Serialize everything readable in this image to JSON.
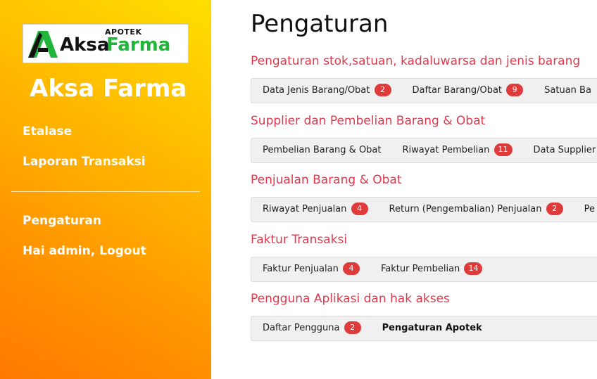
{
  "sidebar": {
    "logo": {
      "apotek": "APOTEK",
      "aksa": "Aksa",
      "farma": "Farma"
    },
    "brand": "Aksa Farma",
    "items": [
      "Etalase",
      "Laporan Transaksi",
      "Pengaturan",
      "Hai admin, Logout"
    ]
  },
  "main": {
    "title": "Pengaturan",
    "sections": [
      {
        "title": "Pengaturan stok,satuan, kadaluwarsa dan jenis barang",
        "links": [
          {
            "label": "Data Jenis Barang/Obat",
            "badge": "2"
          },
          {
            "label": "Daftar Barang/Obat",
            "badge": "9"
          },
          {
            "label": "Satuan Ba",
            "badge": ""
          }
        ]
      },
      {
        "title": "Supplier dan Pembelian Barang & Obat",
        "links": [
          {
            "label": "Pembelian Barang & Obat",
            "badge": ""
          },
          {
            "label": "Riwayat Pembelian",
            "badge": "11"
          },
          {
            "label": "Data Supplier",
            "badge": ""
          }
        ]
      },
      {
        "title": "Penjualan Barang & Obat",
        "links": [
          {
            "label": "Riwayat Penjualan",
            "badge": "4"
          },
          {
            "label": "Return (Pengembalian) Penjualan",
            "badge": "2"
          },
          {
            "label": "Pe",
            "badge": ""
          }
        ]
      },
      {
        "title": "Faktur Transaksi",
        "links": [
          {
            "label": "Faktur Penjualan",
            "badge": "4"
          },
          {
            "label": "Faktur Pembelian",
            "badge": "14"
          }
        ]
      },
      {
        "title": "Pengguna Aplikasi dan hak akses",
        "links": [
          {
            "label": "Daftar Pengguna",
            "badge": "2"
          },
          {
            "label": "Pengaturan Apotek",
            "badge": ""
          }
        ]
      }
    ]
  },
  "colors": {
    "accent_red": "#e0394d",
    "badge_red": "#e03b3b",
    "logo_green": "#22b53b",
    "sidebar_gradient_start": "#ffdf00",
    "sidebar_gradient_end": "#ff7a00"
  }
}
